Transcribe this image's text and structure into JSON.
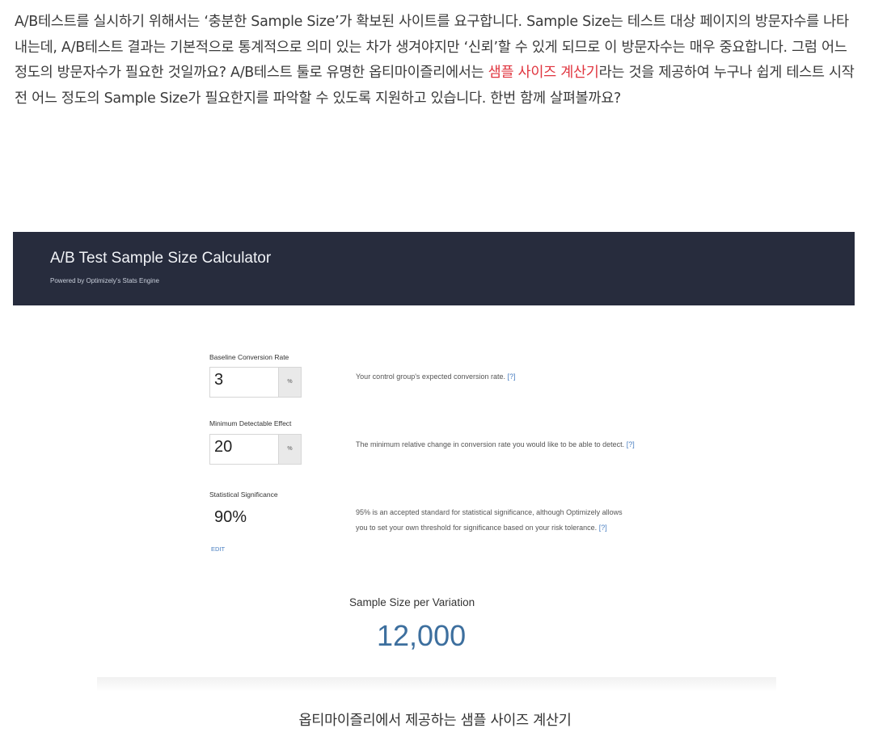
{
  "intro": {
    "text_before_link": "A/B테스트를 실시하기 위해서는 ‘충분한 Sample Size’가 확보된 사이트를 요구합니다. Sample Size는 테스트 대상 페이지의 방문자수를 나타내는데, A/B테스트 결과는 기본적으로 통계적으로 의미 있는 차가 생겨야지만 ‘신뢰’할 수 있게 되므로 이 방문자수는 매우 중요합니다. 그럼 어느 정도의 방문자수가 필요한 것일까요? A/B테스트 툴로 유명한 옵티마이즐리에서는 ",
    "link_text": "샘플 사이즈 계산기",
    "text_after_link": "라는 것을 제공하여 누구나 쉽게 테스트 시작 전 어느 정도의 Sample Size가 필요한지를 파악할 수 있도록 지원하고 있습니다. 한번 함께 살펴볼까요?"
  },
  "calculator": {
    "title": "A/B Test Sample Size Calculator",
    "subtitle": "Powered by Optimizely's Stats Engine",
    "baseline": {
      "label": "Baseline Conversion Rate",
      "value": "3",
      "unit": "%",
      "description": "Your control group's expected conversion rate.",
      "help": "[?]"
    },
    "mde": {
      "label": "Minimum Detectable Effect",
      "value": "20",
      "unit": "%",
      "description": "The minimum relative change in conversion rate you would like to be able to detect.",
      "help": "[?]"
    },
    "significance": {
      "label": "Statistical Significance",
      "value": "90%",
      "edit_label": "EDIT",
      "description": "95% is an accepted standard for statistical significance, although Optimizely allows you to set your own threshold for significance based on your risk tolerance.",
      "help": "[?]"
    },
    "result": {
      "label": "Sample Size per Variation",
      "value": "12,000"
    }
  },
  "caption": "옵티마이즐리에서 제공하는 샘플 사이즈 계산기",
  "colors": {
    "header_bg": "#272c3d",
    "link": "#e0353f",
    "result": "#3d6f9e",
    "help_link": "#4a7fc1"
  }
}
